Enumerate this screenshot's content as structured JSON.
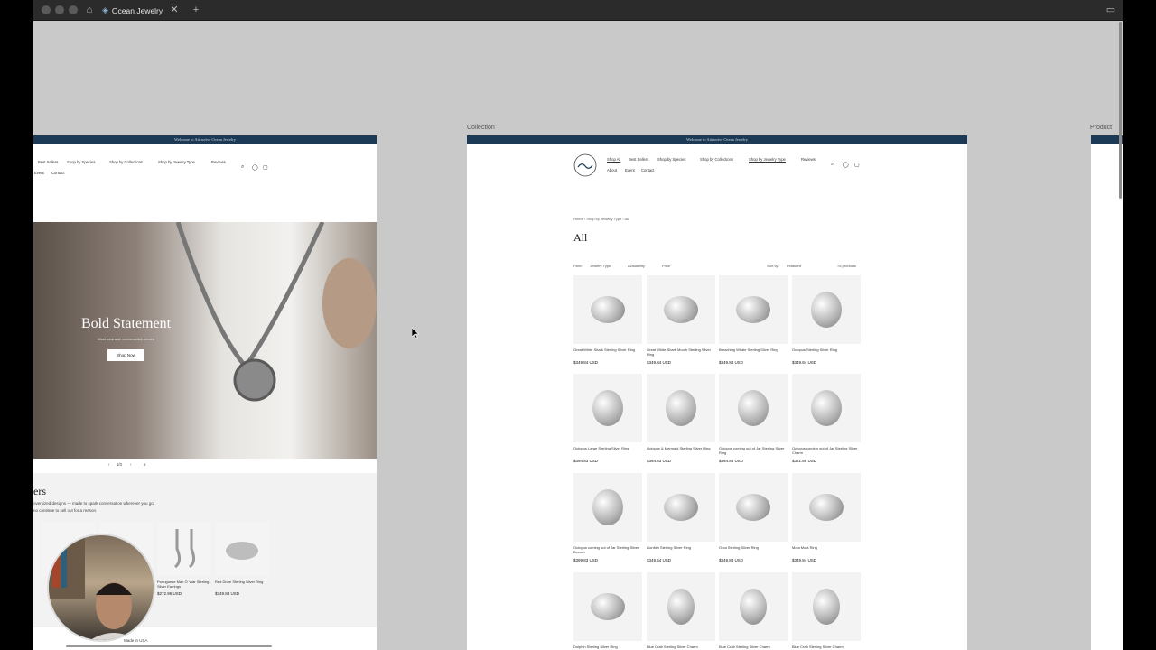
{
  "browser": {
    "tab_title": "Ocean Jewelry"
  },
  "labels": {
    "collection": "Collection",
    "product": "Product"
  },
  "home": {
    "announcement": "Welcome to Attractive Ocean Jewelry",
    "nav": [
      "Best Sellers",
      "Shop by Species",
      "Shop by Collections",
      "Shop by Jewelry Type",
      "Reviews",
      "Event",
      "Contact"
    ],
    "hero_title": "Bold Statement",
    "hero_subtitle": "Most wearable conversation pieces",
    "hero_button": "Shop Now",
    "slide_counter": "1/3",
    "section_title": "ers",
    "section_text_1": "oversized designs — made to spark conversation wherever you go.",
    "section_text_2": "no continue to sell out for a reason.",
    "cards": [
      {
        "name": "Portuguese Man O' War Sterling Silver Earrings",
        "price": "$272.95 USD"
      },
      {
        "name": "Red Drum Sterling Silver Ring",
        "price": "$349.84 USD"
      }
    ],
    "footer": "Made in USA"
  },
  "collection": {
    "announcement": "Welcome to Attractive Ocean Jewelry",
    "nav_row1": [
      "Shop All",
      "Best Sellers",
      "Shop by Species",
      "Shop by Collections",
      "Shop by Jewelry Type",
      "Reviews"
    ],
    "nav_row2": [
      "About",
      "Event",
      "Contact"
    ],
    "breadcrumb": "Home › Shop by Jewelry Type › All",
    "title": "All",
    "filter_label": "Filter:",
    "filters": [
      "Jewelry Type",
      "Availability",
      "Price"
    ],
    "sort_label": "Sort by:",
    "sort_value": "Featured",
    "count": "78 products",
    "products": [
      {
        "name": "Great White Shark Sterling Silver Ring",
        "price": "$349.84 USD"
      },
      {
        "name": "Great White Shark Mouth Sterling Silver Ring",
        "price": "$349.84 USD"
      },
      {
        "name": "Breaching Whale Sterling Silver Ring",
        "price": "$349.84 USD"
      },
      {
        "name": "Octopus Sterling Silver Ring",
        "price": "$349.84 USD"
      },
      {
        "name": "Octopus Large Sterling Silver Ring",
        "price": "$394.83 USD"
      },
      {
        "name": "Octopus & Mermaid Sterling Silver Ring",
        "price": "$394.83 USD"
      },
      {
        "name": "Octopus coming out of Jar Sterling Silver Ring",
        "price": "$394.83 USD"
      },
      {
        "name": "Octopus coming out of Jar Sterling Silver Charm",
        "price": "$321.85 USD"
      },
      {
        "name": "Octopus coming out of Jar Sterling Silver Brooch",
        "price": "$399.83 USD"
      },
      {
        "name": "Lionfish Sterling Silver Ring",
        "price": "$349.54 USD"
      },
      {
        "name": "Orca Sterling Silver Ring",
        "price": "$349.84 USD"
      },
      {
        "name": "Mola Mola Ring",
        "price": "$349.84 USD"
      },
      {
        "name": "Dolphin Sterling Silver Ring",
        "price": ""
      },
      {
        "name": "Blue Crab Sterling Silver Charm",
        "price": ""
      },
      {
        "name": "Blue Crab Sterling Silver Charm",
        "price": ""
      },
      {
        "name": "Blue Crab Sterling Silver Charm",
        "price": ""
      }
    ]
  }
}
